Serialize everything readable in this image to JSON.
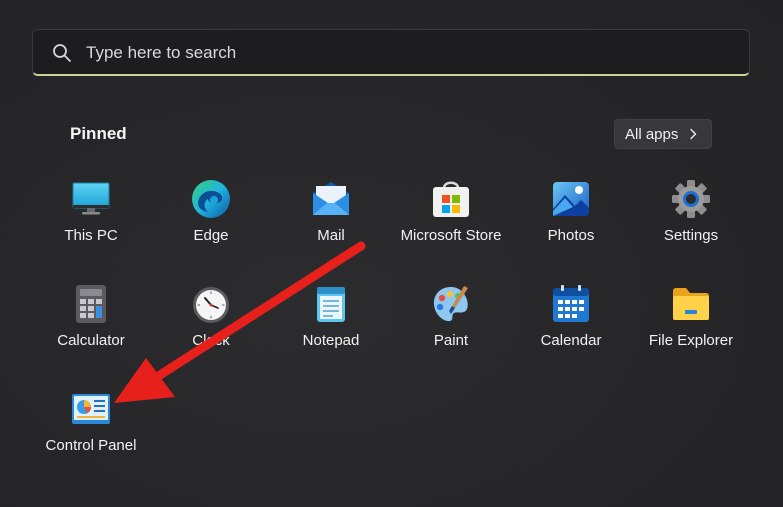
{
  "search": {
    "placeholder": "Type here to search",
    "value": "",
    "accent_color": "#c8d49a"
  },
  "pinned": {
    "title": "Pinned",
    "all_apps_label": "All apps"
  },
  "apps": [
    {
      "label": "This PC",
      "icon": "monitor-icon"
    },
    {
      "label": "Edge",
      "icon": "edge-icon"
    },
    {
      "label": "Mail",
      "icon": "mail-icon"
    },
    {
      "label": "Microsoft Store",
      "icon": "store-icon"
    },
    {
      "label": "Photos",
      "icon": "photos-icon"
    },
    {
      "label": "Settings",
      "icon": "gear-icon"
    },
    {
      "label": "Calculator",
      "icon": "calculator-icon"
    },
    {
      "label": "Clock",
      "icon": "clock-icon"
    },
    {
      "label": "Notepad",
      "icon": "notepad-icon"
    },
    {
      "label": "Paint",
      "icon": "paint-palette-icon"
    },
    {
      "label": "Calendar",
      "icon": "calendar-icon"
    },
    {
      "label": "File Explorer",
      "icon": "folder-icon"
    },
    {
      "label": "Control Panel",
      "icon": "control-panel-icon"
    }
  ],
  "annotation": {
    "color": "#e8201c",
    "points_to": "Control Panel"
  }
}
